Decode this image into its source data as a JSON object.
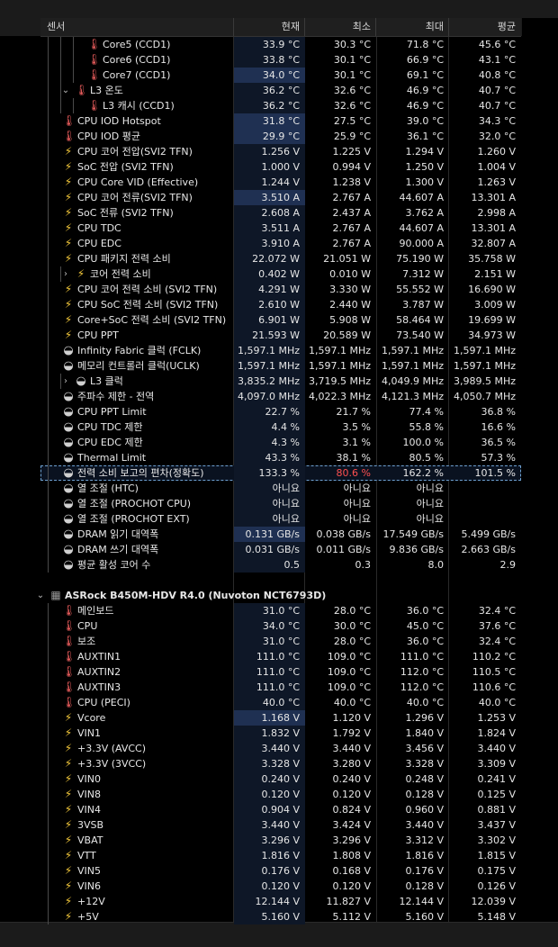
{
  "header": {
    "sensor": "센서",
    "current": "현재",
    "min": "최소",
    "max": "최대",
    "avg": "평균"
  },
  "rows": [
    {
      "name": "Core5 (CCD1)",
      "icon": "thermometer-icon",
      "indent": 3,
      "cur": "33.9 °C",
      "min": "30.3 °C",
      "max": "71.8 °C",
      "avg": "45.6 °C"
    },
    {
      "name": "Core6 (CCD1)",
      "icon": "thermometer-icon",
      "indent": 3,
      "cur": "33.8 °C",
      "min": "30.1 °C",
      "max": "66.9 °C",
      "avg": "43.1 °C"
    },
    {
      "name": "Core7 (CCD1)",
      "icon": "thermometer-icon",
      "indent": 3,
      "cur": "34.0 °C",
      "min": "30.1 °C",
      "max": "69.1 °C",
      "avg": "40.8 °C",
      "hi": true
    },
    {
      "name": "L3 온도",
      "icon": "thermometer-icon",
      "indent": 2,
      "toggle": "v",
      "cur": "36.2 °C",
      "min": "32.6 °C",
      "max": "46.9 °C",
      "avg": "40.7 °C"
    },
    {
      "name": "L3 캐시 (CCD1)",
      "icon": "thermometer-icon",
      "indent": 3,
      "cur": "36.2 °C",
      "min": "32.6 °C",
      "max": "46.9 °C",
      "avg": "40.7 °C"
    },
    {
      "name": "CPU IOD Hotspot",
      "icon": "thermometer-icon",
      "indent": 1,
      "cur": "31.8 °C",
      "min": "27.5 °C",
      "max": "39.0 °C",
      "avg": "34.3 °C",
      "hi": true
    },
    {
      "name": "CPU IOD 평균",
      "icon": "thermometer-icon",
      "indent": 1,
      "cur": "29.9 °C",
      "min": "25.9 °C",
      "max": "36.1 °C",
      "avg": "32.0 °C",
      "hi": true
    },
    {
      "name": "CPU 코어 전압(SVI2 TFN)",
      "icon": "lightning-icon",
      "indent": 1,
      "cur": "1.256 V",
      "min": "1.225 V",
      "max": "1.294 V",
      "avg": "1.260 V"
    },
    {
      "name": "SoC 전압 (SVI2 TFN)",
      "icon": "lightning-icon",
      "indent": 1,
      "cur": "1.000 V",
      "min": "0.994 V",
      "max": "1.250 V",
      "avg": "1.004 V"
    },
    {
      "name": "CPU Core VID (Effective)",
      "icon": "lightning-icon",
      "indent": 1,
      "cur": "1.244 V",
      "min": "1.238 V",
      "max": "1.300 V",
      "avg": "1.263 V"
    },
    {
      "name": "CPU 코어 전류(SVI2 TFN)",
      "icon": "lightning-icon",
      "indent": 1,
      "cur": "3.510 A",
      "min": "2.767 A",
      "max": "44.607 A",
      "avg": "13.301 A",
      "hi": true
    },
    {
      "name": "SoC 전류 (SVI2 TFN)",
      "icon": "lightning-icon",
      "indent": 1,
      "cur": "2.608 A",
      "min": "2.437 A",
      "max": "3.762 A",
      "avg": "2.998 A"
    },
    {
      "name": "CPU TDC",
      "icon": "lightning-icon",
      "indent": 1,
      "cur": "3.511 A",
      "min": "2.767 A",
      "max": "44.607 A",
      "avg": "13.301 A"
    },
    {
      "name": "CPU EDC",
      "icon": "lightning-icon",
      "indent": 1,
      "cur": "3.910 A",
      "min": "2.767 A",
      "max": "90.000 A",
      "avg": "32.807 A"
    },
    {
      "name": "CPU 패키지 전력 소비",
      "icon": "lightning-icon",
      "indent": 1,
      "cur": "22.072 W",
      "min": "21.051 W",
      "max": "75.190 W",
      "avg": "35.758 W"
    },
    {
      "name": "코어 전력 소비",
      "icon": "lightning-icon",
      "indent": 2,
      "toggle": ">",
      "cur": "0.402 W",
      "min": "0.010 W",
      "max": "7.312 W",
      "avg": "2.151 W"
    },
    {
      "name": "CPU 코어 전력 소비 (SVI2 TFN)",
      "icon": "lightning-icon",
      "indent": 1,
      "cur": "4.291 W",
      "min": "3.330 W",
      "max": "55.552 W",
      "avg": "16.690 W"
    },
    {
      "name": "CPU SoC 전력 소비 (SVI2 TFN)",
      "icon": "lightning-icon",
      "indent": 1,
      "cur": "2.610 W",
      "min": "2.440 W",
      "max": "3.787 W",
      "avg": "3.009 W"
    },
    {
      "name": "Core+SoC 전력 소비 (SVI2 TFN)",
      "icon": "lightning-icon",
      "indent": 1,
      "cur": "6.901 W",
      "min": "5.908 W",
      "max": "58.464 W",
      "avg": "19.699 W"
    },
    {
      "name": "CPU PPT",
      "icon": "lightning-icon",
      "indent": 1,
      "cur": "21.593 W",
      "min": "20.589 W",
      "max": "73.540 W",
      "avg": "34.973 W"
    },
    {
      "name": "Infinity Fabric 클럭 (FCLK)",
      "icon": "gauge-icon",
      "indent": 1,
      "cur": "1,597.1 MHz",
      "min": "1,597.1 MHz",
      "max": "1,597.1 MHz",
      "avg": "1,597.1 MHz"
    },
    {
      "name": "메모리 컨트롤러 클럭(UCLK)",
      "icon": "gauge-icon",
      "indent": 1,
      "cur": "1,597.1 MHz",
      "min": "1,597.1 MHz",
      "max": "1,597.1 MHz",
      "avg": "1,597.1 MHz"
    },
    {
      "name": "L3 클럭",
      "icon": "gauge-icon",
      "indent": 2,
      "toggle": ">",
      "cur": "3,835.2 MHz",
      "min": "3,719.5 MHz",
      "max": "4,049.9 MHz",
      "avg": "3,989.5 MHz"
    },
    {
      "name": "주파수 제한 - 전역",
      "icon": "gauge-icon",
      "indent": 1,
      "cur": "4,097.0 MHz",
      "min": "4,022.3 MHz",
      "max": "4,121.3 MHz",
      "avg": "4,050.7 MHz"
    },
    {
      "name": "CPU PPT Limit",
      "icon": "gauge-icon",
      "indent": 1,
      "cur": "22.7 %",
      "min": "21.7 %",
      "max": "77.4 %",
      "avg": "36.8 %"
    },
    {
      "name": "CPU TDC 제한",
      "icon": "gauge-icon",
      "indent": 1,
      "cur": "4.4 %",
      "min": "3.5 %",
      "max": "55.8 %",
      "avg": "16.6 %"
    },
    {
      "name": "CPU EDC 제한",
      "icon": "gauge-icon",
      "indent": 1,
      "cur": "4.3 %",
      "min": "3.1 %",
      "max": "100.0 %",
      "avg": "36.5 %"
    },
    {
      "name": "Thermal Limit",
      "icon": "gauge-icon",
      "indent": 1,
      "cur": "43.3 %",
      "min": "38.1 %",
      "max": "80.5 %",
      "avg": "57.3 %"
    },
    {
      "name": "전력 소비 보고의 편차(정확도)",
      "icon": "gauge-icon",
      "indent": 1,
      "cur": "133.3 %",
      "min": "80.6 %",
      "max": "162.2 %",
      "avg": "101.5 %",
      "selected": true,
      "minRed": true
    },
    {
      "name": "열 조절 (HTC)",
      "icon": "gauge-icon",
      "indent": 1,
      "cur": "아니요",
      "min": "아니요",
      "max": "아니요",
      "avg": ""
    },
    {
      "name": "열 조절 (PROCHOT CPU)",
      "icon": "gauge-icon",
      "indent": 1,
      "cur": "아니요",
      "min": "아니요",
      "max": "아니요",
      "avg": ""
    },
    {
      "name": "열 조절 (PROCHOT EXT)",
      "icon": "gauge-icon",
      "indent": 1,
      "cur": "아니요",
      "min": "아니요",
      "max": "아니요",
      "avg": ""
    },
    {
      "name": "DRAM 읽기 대역폭",
      "icon": "gauge-icon",
      "indent": 1,
      "cur": "0.131 GB/s",
      "min": "0.038 GB/s",
      "max": "17.549 GB/s",
      "avg": "5.499 GB/s",
      "hi": true
    },
    {
      "name": "DRAM 쓰기 대역폭",
      "icon": "gauge-icon",
      "indent": 1,
      "cur": "0.031 GB/s",
      "min": "0.011 GB/s",
      "max": "9.836 GB/s",
      "avg": "2.663 GB/s"
    },
    {
      "name": "평균 활성 코어 수",
      "icon": "gauge-icon",
      "indent": 1,
      "cur": "0.5",
      "min": "0.3",
      "max": "8.0",
      "avg": "2.9"
    },
    {
      "name": "",
      "blank": true
    },
    {
      "name": "ASRock B450M-HDV R4.0 (Nuvoton NCT6793D)",
      "icon": "chip-icon",
      "indent": 0,
      "toggle": "v",
      "group": true
    },
    {
      "name": "메인보드",
      "icon": "thermometer-icon",
      "indent": 1,
      "cur": "31.0 °C",
      "min": "28.0 °C",
      "max": "36.0 °C",
      "avg": "32.4 °C"
    },
    {
      "name": "CPU",
      "icon": "thermometer-icon",
      "indent": 1,
      "cur": "34.0 °C",
      "min": "30.0 °C",
      "max": "45.0 °C",
      "avg": "37.6 °C"
    },
    {
      "name": "보조",
      "icon": "thermometer-icon",
      "indent": 1,
      "cur": "31.0 °C",
      "min": "28.0 °C",
      "max": "36.0 °C",
      "avg": "32.4 °C"
    },
    {
      "name": "AUXTIN1",
      "icon": "thermometer-icon",
      "indent": 1,
      "cur": "111.0 °C",
      "min": "109.0 °C",
      "max": "111.0 °C",
      "avg": "110.2 °C"
    },
    {
      "name": "AUXTIN2",
      "icon": "thermometer-icon",
      "indent": 1,
      "cur": "111.0 °C",
      "min": "109.0 °C",
      "max": "112.0 °C",
      "avg": "110.5 °C"
    },
    {
      "name": "AUXTIN3",
      "icon": "thermometer-icon",
      "indent": 1,
      "cur": "111.0 °C",
      "min": "109.0 °C",
      "max": "112.0 °C",
      "avg": "110.6 °C"
    },
    {
      "name": "CPU (PECI)",
      "icon": "thermometer-icon",
      "indent": 1,
      "cur": "40.0 °C",
      "min": "40.0 °C",
      "max": "40.0 °C",
      "avg": "40.0 °C"
    },
    {
      "name": "Vcore",
      "icon": "lightning-icon",
      "indent": 1,
      "cur": "1.168 V",
      "min": "1.120 V",
      "max": "1.296 V",
      "avg": "1.253 V",
      "hi": true
    },
    {
      "name": "VIN1",
      "icon": "lightning-icon",
      "indent": 1,
      "cur": "1.832 V",
      "min": "1.792 V",
      "max": "1.840 V",
      "avg": "1.824 V"
    },
    {
      "name": "+3.3V (AVCC)",
      "icon": "lightning-icon",
      "indent": 1,
      "cur": "3.440 V",
      "min": "3.440 V",
      "max": "3.456 V",
      "avg": "3.440 V"
    },
    {
      "name": "+3.3V (3VCC)",
      "icon": "lightning-icon",
      "indent": 1,
      "cur": "3.328 V",
      "min": "3.280 V",
      "max": "3.328 V",
      "avg": "3.309 V"
    },
    {
      "name": "VIN0",
      "icon": "lightning-icon",
      "indent": 1,
      "cur": "0.240 V",
      "min": "0.240 V",
      "max": "0.248 V",
      "avg": "0.241 V"
    },
    {
      "name": "VIN8",
      "icon": "lightning-icon",
      "indent": 1,
      "cur": "0.120 V",
      "min": "0.120 V",
      "max": "0.128 V",
      "avg": "0.125 V"
    },
    {
      "name": "VIN4",
      "icon": "lightning-icon",
      "indent": 1,
      "cur": "0.904 V",
      "min": "0.824 V",
      "max": "0.960 V",
      "avg": "0.881 V"
    },
    {
      "name": "3VSB",
      "icon": "lightning-icon",
      "indent": 1,
      "cur": "3.440 V",
      "min": "3.424 V",
      "max": "3.440 V",
      "avg": "3.437 V"
    },
    {
      "name": "VBAT",
      "icon": "lightning-icon",
      "indent": 1,
      "cur": "3.296 V",
      "min": "3.296 V",
      "max": "3.312 V",
      "avg": "3.302 V"
    },
    {
      "name": "VTT",
      "icon": "lightning-icon",
      "indent": 1,
      "cur": "1.816 V",
      "min": "1.808 V",
      "max": "1.816 V",
      "avg": "1.815 V"
    },
    {
      "name": "VIN5",
      "icon": "lightning-icon",
      "indent": 1,
      "cur": "0.176 V",
      "min": "0.168 V",
      "max": "0.176 V",
      "avg": "0.175 V"
    },
    {
      "name": "VIN6",
      "icon": "lightning-icon",
      "indent": 1,
      "cur": "0.120 V",
      "min": "0.120 V",
      "max": "0.128 V",
      "avg": "0.126 V"
    },
    {
      "name": "+12V",
      "icon": "lightning-icon",
      "indent": 1,
      "cur": "12.144 V",
      "min": "11.827 V",
      "max": "12.144 V",
      "avg": "12.039 V"
    },
    {
      "name": "+5V",
      "icon": "lightning-icon",
      "indent": 1,
      "cur": "5.160 V",
      "min": "5.112 V",
      "max": "5.160 V",
      "avg": "5.148 V"
    }
  ]
}
